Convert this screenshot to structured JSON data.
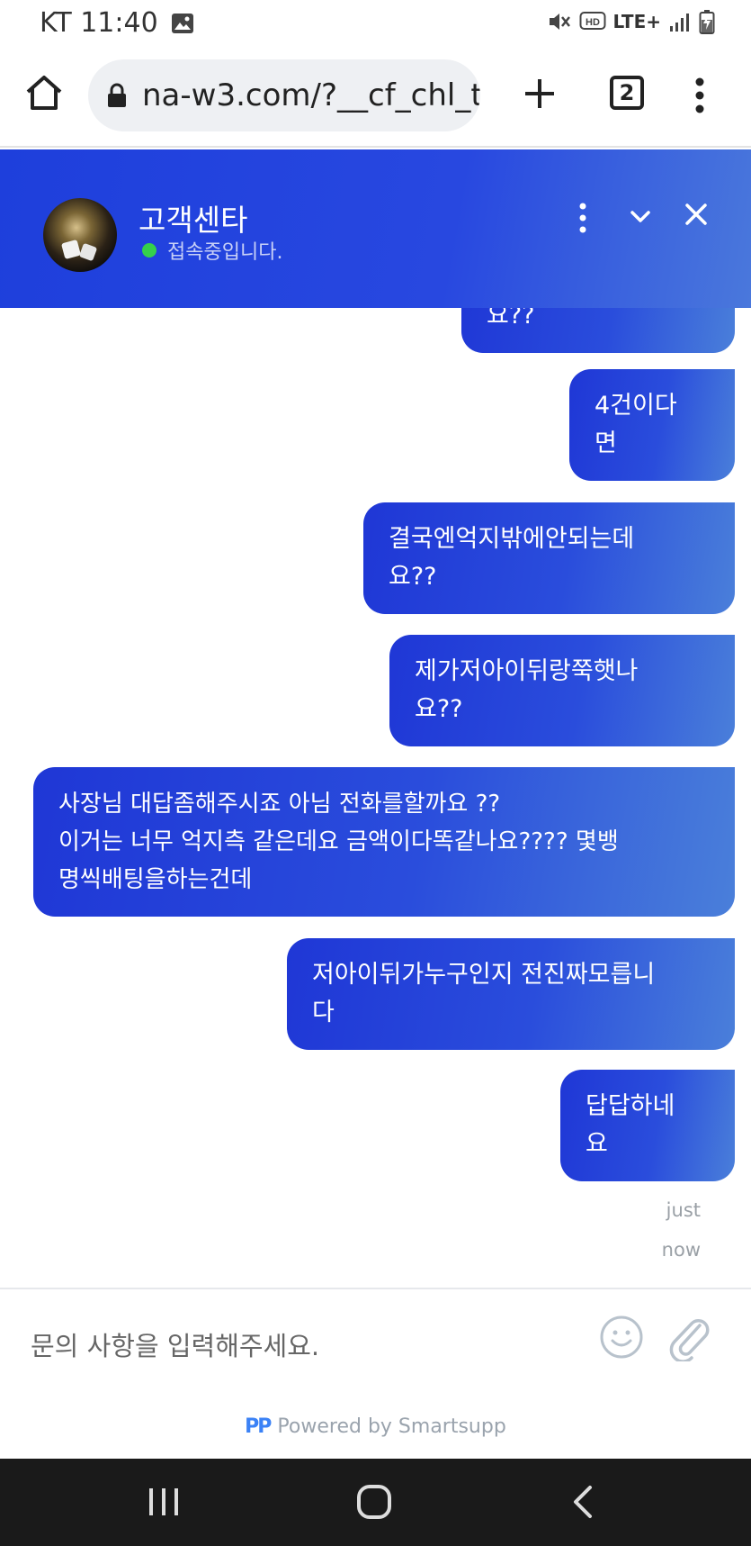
{
  "status_bar": {
    "carrier_time": "KT 11:40",
    "network": "LTE+"
  },
  "browser": {
    "url": "na-w3.com/?__cf_chl_t",
    "tab_count": "2"
  },
  "chat": {
    "title": "고객센타",
    "status": "접속중입니다.",
    "messages": [
      {
        "text": "요??",
        "lines": [
          "요??"
        ]
      },
      {
        "text": "4건이다면",
        "lines": [
          "4건이다",
          "면"
        ]
      },
      {
        "text": "결국엔억지밖에안되는데요??",
        "lines": [
          "결국엔억지밖에안되는데",
          "요??"
        ]
      },
      {
        "text": "제가저아이뒤랑쭉햇나요??",
        "lines": [
          "제가저아이뒤랑쭉햇나",
          "요??"
        ]
      },
      {
        "text": "사장님 대답좀해주시죠 아님 전화를할까요 ?? 이거는 너무 억지측 같은데요 금액이다똑같나요???? 몇뱅명씩배팅을하는건데",
        "lines": [
          "사장님 대답좀해주시죠 아님 전화를할까요 ??",
          "이거는 너무 억지측 같은데요 금액이다똑같나요???? 몇뱅",
          "명씩배팅을하는건데"
        ]
      },
      {
        "text": "저아이뒤가누구인지 전진짜모릅니다",
        "lines": [
          "저아이뒤가누구인지 전진짜모릅니",
          "다"
        ]
      },
      {
        "text": "답답하네요",
        "lines": [
          "답답하네",
          "요"
        ]
      }
    ],
    "timestamp_lines": [
      "just",
      "now"
    ]
  },
  "composer": {
    "placeholder": "문의 사항을 입력해주세요.",
    "powered_by": "Powered by Smartsupp",
    "logo_text": "PP"
  },
  "colors": {
    "header_gradient_start": "#1e3fdc",
    "header_gradient_end": "#4a78dc",
    "online": "#35d04b"
  }
}
